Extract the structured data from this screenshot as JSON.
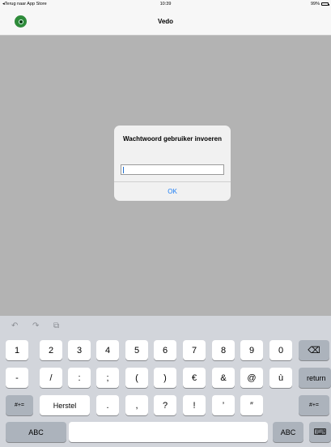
{
  "status_bar": {
    "back_label": "◂Terug naar App Store",
    "time": "10:39",
    "battery_label": "99%",
    "battery_level": 0.99
  },
  "nav": {
    "title": "Vedo",
    "logo_icon": "vedo-logo-icon"
  },
  "alert": {
    "title": "Wachtwoord gebruiker invoeren",
    "input_value": "",
    "ok_label": "OK",
    "accent_color": "#1a7cf4"
  },
  "keyboard": {
    "toolbar": {
      "undo_icon": "↶",
      "redo_icon": "↷",
      "paste_icon": "⧉"
    },
    "row1": [
      "1",
      "2",
      "3",
      "4",
      "5",
      "6",
      "7",
      "8",
      "9",
      "0"
    ],
    "backspace_icon": "⌫",
    "row2": [
      "-",
      "/",
      ":",
      ";",
      "(",
      ")",
      "€",
      "&",
      "@",
      "ù"
    ],
    "return_label": "return",
    "shift_label": "#+=",
    "undo_label": "Herstel",
    "row3": [
      ".",
      ",",
      "?",
      "!",
      "’",
      "″"
    ],
    "shift_right_label": "#+=",
    "abc_left_label": "ABC",
    "space_label": "",
    "abc_right_label": "ABC",
    "dismiss_icon": "⌨"
  }
}
